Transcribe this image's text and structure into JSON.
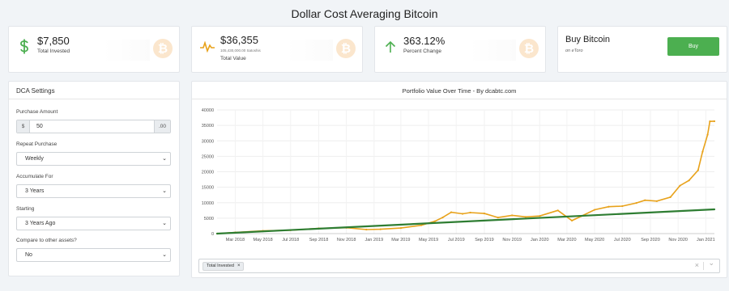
{
  "page_title": "Dollar Cost Averaging Bitcoin",
  "stats": {
    "invested": {
      "value": "$7,850",
      "label": "Total Invested",
      "icon": "dollar-icon"
    },
    "total_value": {
      "value": "$36,355",
      "satoshis": "105,430,000.00 Satoshis",
      "label": "Total Value",
      "icon": "pulse-icon"
    },
    "change": {
      "value": "363.12%",
      "label": "Percent Change",
      "icon": "arrow-up-icon"
    },
    "buy": {
      "title": "Buy Bitcoin",
      "subtitle": "on eToro",
      "button": "Buy"
    }
  },
  "settings": {
    "title": "DCA Settings",
    "purchase_amount_label": "Purchase Amount",
    "currency_prefix": "$",
    "purchase_amount": "50",
    "cents_suffix": ".00",
    "repeat_label": "Repeat Purchase",
    "repeat_value": "Weekly",
    "accumulate_label": "Accumulate For",
    "accumulate_value": "3 Years",
    "starting_label": "Starting",
    "starting_value": "3 Years Ago",
    "compare_label": "Compare to other assets?",
    "compare_value": "No"
  },
  "filter": {
    "tag": "Total Invested",
    "clear": "×",
    "dropdown": "⌄"
  },
  "colors": {
    "value_series": "#e8a21b",
    "invested_series": "#2e7d32",
    "buy_button": "#4caf50",
    "bitcoin_badge": "#fbe6cd"
  },
  "chart_data": {
    "type": "line",
    "title": "Portfolio Value Over Time - By dcabtc.com",
    "ylim": [
      0,
      40000
    ],
    "y_ticks": [
      0,
      5000,
      10000,
      15000,
      20000,
      25000,
      30000,
      35000,
      40000
    ],
    "x_ticks": [
      "Mar 2018",
      "May 2018",
      "Jul 2018",
      "Sep 2018",
      "Nov 2018",
      "Jan 2019",
      "Mar 2019",
      "May 2019",
      "Jul 2019",
      "Sep 2019",
      "Nov 2019",
      "Jan 2020",
      "Mar 2020",
      "May 2020",
      "Jul 2020",
      "Sep 2020",
      "Nov 2020",
      "Jan 2021"
    ],
    "x_range": [
      "2018-01-20",
      "2021-01-20"
    ],
    "series": [
      {
        "name": "Total Value",
        "color": "#e8a21b",
        "points": [
          [
            "2018-01-20",
            0
          ],
          [
            "2018-03-01",
            400
          ],
          [
            "2018-05-01",
            900
          ],
          [
            "2018-07-01",
            1100
          ],
          [
            "2018-09-01",
            1700
          ],
          [
            "2018-11-01",
            1900
          ],
          [
            "2018-12-15",
            1300
          ],
          [
            "2019-01-15",
            1400
          ],
          [
            "2019-03-01",
            1800
          ],
          [
            "2019-04-15",
            2700
          ],
          [
            "2019-05-15",
            4000
          ],
          [
            "2019-06-01",
            5200
          ],
          [
            "2019-06-20",
            6900
          ],
          [
            "2019-07-15",
            6400
          ],
          [
            "2019-08-01",
            6800
          ],
          [
            "2019-09-01",
            6500
          ],
          [
            "2019-10-01",
            5200
          ],
          [
            "2019-11-01",
            5900
          ],
          [
            "2019-12-01",
            5400
          ],
          [
            "2020-01-01",
            5700
          ],
          [
            "2020-02-10",
            7500
          ],
          [
            "2020-03-12",
            4200
          ],
          [
            "2020-04-01",
            5600
          ],
          [
            "2020-05-01",
            7700
          ],
          [
            "2020-06-01",
            8700
          ],
          [
            "2020-07-01",
            8900
          ],
          [
            "2020-08-01",
            9900
          ],
          [
            "2020-08-20",
            10800
          ],
          [
            "2020-09-15",
            10500
          ],
          [
            "2020-10-15",
            11800
          ],
          [
            "2020-11-05",
            15500
          ],
          [
            "2020-11-25",
            17200
          ],
          [
            "2020-12-15",
            20500
          ],
          [
            "2020-12-25",
            26500
          ],
          [
            "2021-01-05",
            32000
          ],
          [
            "2021-01-10",
            36300
          ],
          [
            "2021-01-20",
            36355
          ]
        ]
      },
      {
        "name": "Total Invested",
        "color": "#2e7d32",
        "points": [
          [
            "2018-01-20",
            0
          ],
          [
            "2021-01-20",
            7850
          ]
        ]
      }
    ]
  }
}
